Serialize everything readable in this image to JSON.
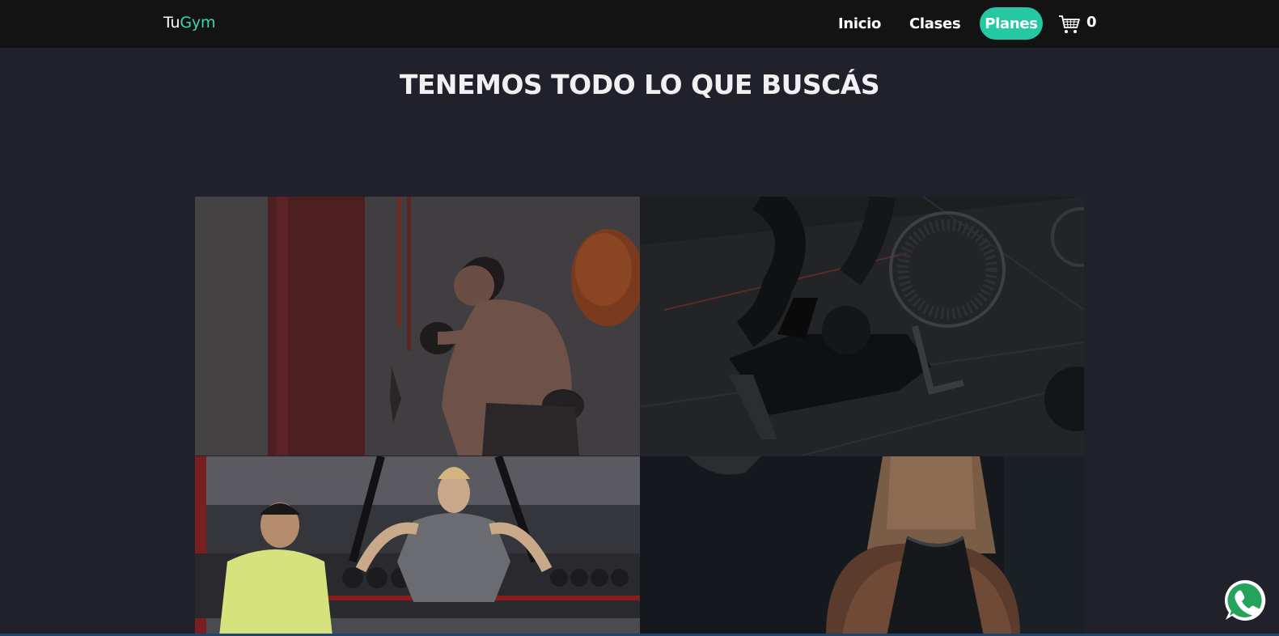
{
  "brand": {
    "part1": "Tu",
    "part2": "Gym"
  },
  "nav": {
    "items": [
      {
        "label": "Inicio"
      },
      {
        "label": "Clases"
      },
      {
        "label": "Planes",
        "active": true
      }
    ],
    "cart": {
      "icon": "cart-icon",
      "count": "0"
    }
  },
  "main": {
    "heading": "TENEMOS TODO LO QUE BUSCÁS"
  },
  "gallery": {
    "images": [
      {
        "name": "boxing-training-image"
      },
      {
        "name": "air-bike-image"
      },
      {
        "name": "suspension-training-image"
      },
      {
        "name": "athlete-back-image"
      }
    ]
  },
  "floating": {
    "icon": "whatsapp-icon"
  },
  "colors": {
    "accent": "#24c9a4",
    "brand_accent": "#3ad6b2",
    "navbar": "#131314",
    "background": "#20212a"
  }
}
